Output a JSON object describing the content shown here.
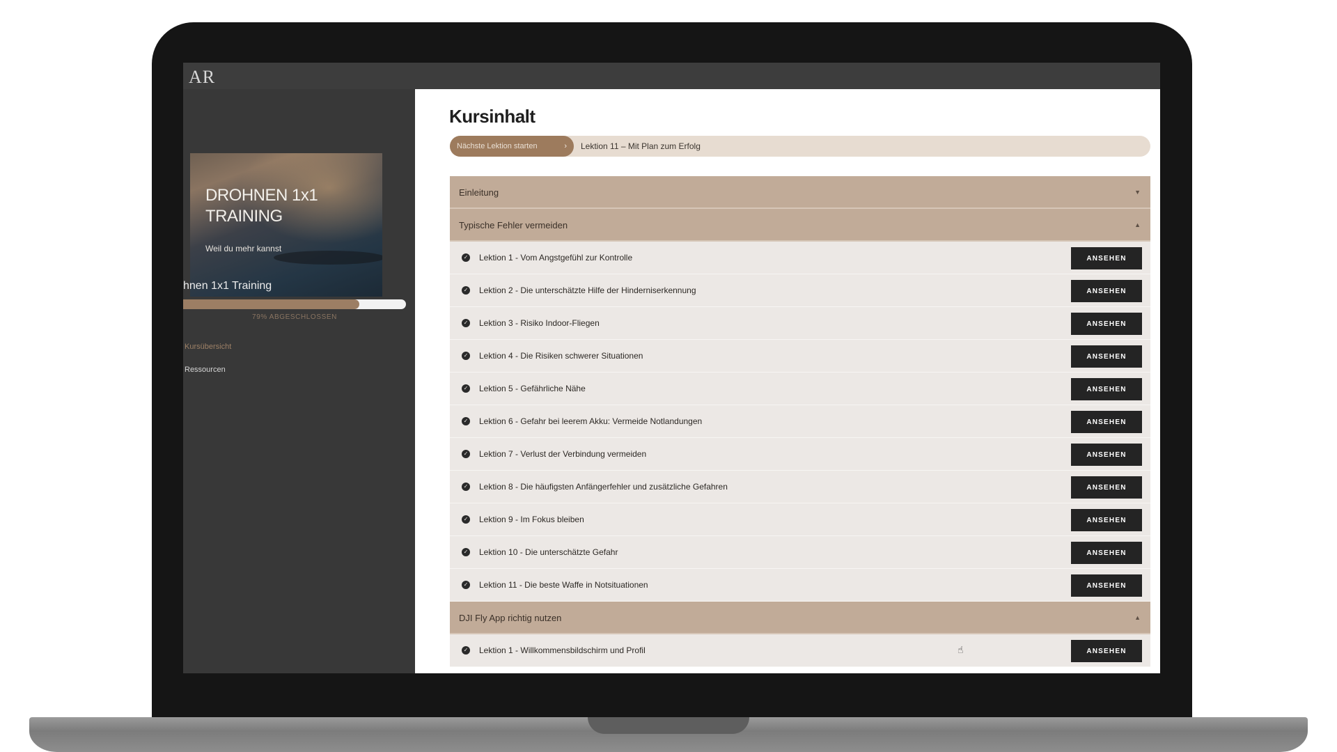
{
  "logo": "AR",
  "sidebar": {
    "banner_title_line1": "DROHNEN 1x1",
    "banner_title_line2": "TRAINING",
    "banner_subtitle": "Weil du mehr kannst",
    "course_name": "hnen 1x1 Training",
    "progress_percent": 79,
    "progress_label": "79% ABGESCHLOSSEN",
    "nav": [
      {
        "label": "Kursübersicht",
        "active": true
      },
      {
        "label": "Ressourcen",
        "active": false
      }
    ]
  },
  "main": {
    "title": "Kursinhalt",
    "next_button_label": "Nächste Lektion starten",
    "next_lesson_title": "Lektion 11 – Mit Plan zum Erfolg",
    "watch_label": "ANSEHEN",
    "sections": [
      {
        "title": "Einleitung",
        "expanded": false,
        "lessons": []
      },
      {
        "title": "Typische Fehler vermeiden",
        "expanded": true,
        "lessons": [
          "Lektion 1 - Vom Angstgefühl zur Kontrolle",
          "Lektion 2 - Die unterschätzte Hilfe der Hinderniserkennung",
          "Lektion 3 - Risiko Indoor-Fliegen",
          "Lektion 4 - Die Risiken schwerer Situationen",
          "Lektion 5 - Gefährliche Nähe",
          "Lektion 6 - Gefahr bei leerem Akku: Vermeide Notlandungen",
          "Lektion 7 - Verlust der Verbindung vermeiden",
          "Lektion 8 - Die häufigsten Anfängerfehler und zusätzliche Gefahren",
          "Lektion 9 - Im Fokus bleiben",
          "Lektion 10 - Die unterschätzte Gefahr",
          "Lektion 11 - Die beste Waffe in Notsituationen"
        ]
      },
      {
        "title": "DJI Fly App richtig nutzen",
        "expanded": true,
        "lessons": [
          "Lektion 1 - Willkommensbildschirm und Profil"
        ]
      }
    ]
  },
  "colors": {
    "accent": "#9d7b5d",
    "section_header": "#c1ab98",
    "lesson_row": "#ece8e5",
    "sidebar_bg": "#383838"
  },
  "icons": {
    "lesson_status": "check-circle-icon",
    "collapsed": "caret-down-icon",
    "expanded": "caret-up-icon",
    "next": "chevron-right-icon"
  }
}
